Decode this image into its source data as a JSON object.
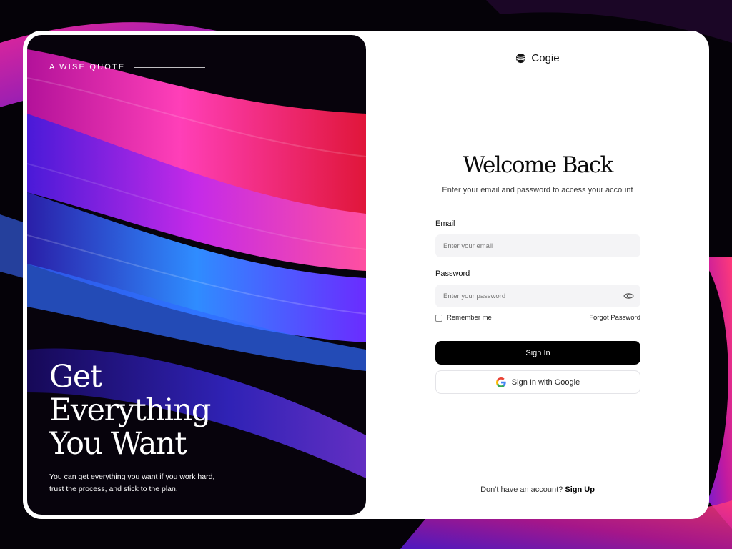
{
  "colors": {
    "primary_button": "#000000",
    "field_background": "#f4f4f6",
    "accent_pink": "#ff2aa8",
    "accent_blue": "#2d7bff",
    "accent_purple": "#6a2cff"
  },
  "hero": {
    "eyebrow": "A WISE QUOTE",
    "title_lines": [
      "Get",
      "Everything",
      "You Want"
    ],
    "subtitle": "You can get everything you want if you work hard, trust the process, and stick to the plan."
  },
  "brand": {
    "name": "Cogie",
    "icon": "cogie-logo-icon"
  },
  "login": {
    "title": "Welcome Back",
    "subtitle": "Enter your email and password to access your account",
    "email_label": "Email",
    "email_placeholder": "Enter your email",
    "password_label": "Password",
    "password_placeholder": "Enter your password",
    "show_password_icon": "eye-icon",
    "remember_label": "Remember me",
    "forgot_label": "Forgot Password",
    "sign_in_label": "Sign In",
    "google_label": "Sign In with Google",
    "google_icon": "google-icon"
  },
  "footer": {
    "prompt": "Don't have an account?",
    "signup_label": "Sign Up"
  }
}
